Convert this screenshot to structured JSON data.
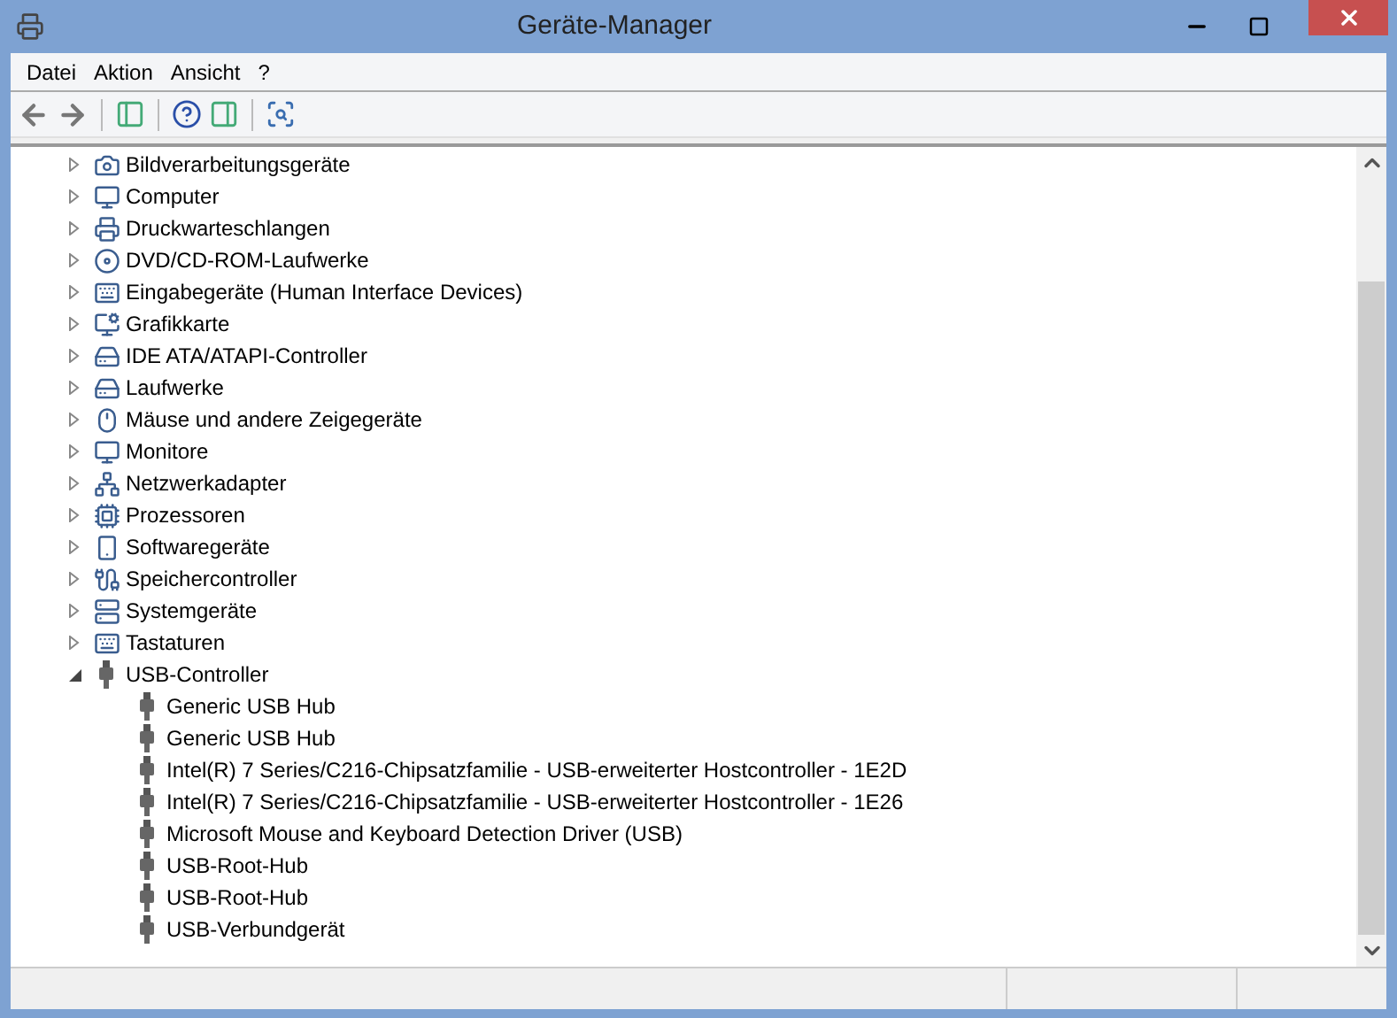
{
  "window": {
    "title": "Geräte-Manager"
  },
  "menu": [
    "Datei",
    "Aktion",
    "Ansicht",
    "?"
  ],
  "tree": [
    {
      "label": "Bildverarbeitungsgeräte",
      "expanded": false
    },
    {
      "label": "Computer",
      "expanded": false
    },
    {
      "label": "Druckwarteschlangen",
      "expanded": false
    },
    {
      "label": "DVD/CD-ROM-Laufwerke",
      "expanded": false
    },
    {
      "label": "Eingabegeräte (Human Interface Devices)",
      "expanded": false
    },
    {
      "label": "Grafikkarte",
      "expanded": false
    },
    {
      "label": "IDE ATA/ATAPI-Controller",
      "expanded": false
    },
    {
      "label": "Laufwerke",
      "expanded": false
    },
    {
      "label": "Mäuse und andere Zeigegeräte",
      "expanded": false
    },
    {
      "label": "Monitore",
      "expanded": false
    },
    {
      "label": "Netzwerkadapter",
      "expanded": false
    },
    {
      "label": "Prozessoren",
      "expanded": false
    },
    {
      "label": "Softwaregeräte",
      "expanded": false
    },
    {
      "label": "Speichercontroller",
      "expanded": false
    },
    {
      "label": "Systemgeräte",
      "expanded": false
    },
    {
      "label": "Tastaturen",
      "expanded": false
    },
    {
      "label": "USB-Controller",
      "expanded": true,
      "children": [
        {
          "label": "Generic USB Hub"
        },
        {
          "label": "Generic USB Hub"
        },
        {
          "label": "Intel(R) 7 Series/C216-Chipsatzfamilie - USB-erweiterter Hostcontroller - 1E2D"
        },
        {
          "label": "Intel(R) 7 Series/C216-Chipsatzfamilie - USB-erweiterter Hostcontroller - 1E26"
        },
        {
          "label": "Microsoft Mouse and Keyboard Detection Driver (USB)"
        },
        {
          "label": "USB-Root-Hub"
        },
        {
          "label": "USB-Root-Hub"
        },
        {
          "label": "USB-Verbundgerät"
        }
      ]
    }
  ]
}
